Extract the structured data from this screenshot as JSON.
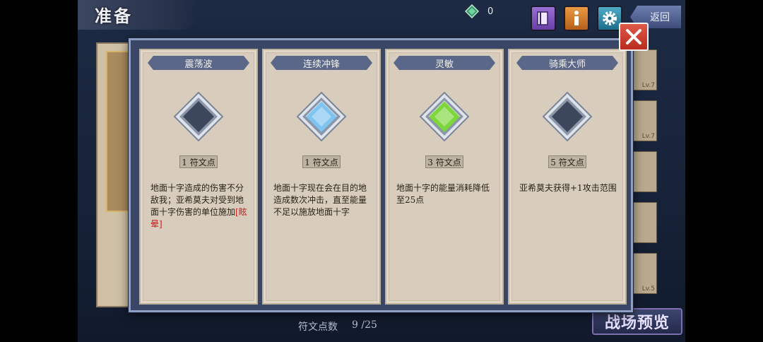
{
  "header": {
    "title": "准备",
    "gem_count": "0",
    "back_label": "返回"
  },
  "background": {
    "slot_levels": [
      "Lv.7",
      "Lv.7",
      "",
      "",
      "Lv.5"
    ],
    "battle_preview_label": "战场预览",
    "rune_points_label": "符文点数",
    "rune_points_value": "9 /25"
  },
  "cards": [
    {
      "title": "震荡波",
      "state": "inactive",
      "cost": "1 符文点",
      "desc": "地面十字造成的伤害不分敌我；亚希莫夫对受到地面十字伤害的单位施加",
      "highlight": "[眩晕]"
    },
    {
      "title": "连续冲锋",
      "state": "blue",
      "cost": "1 符文点",
      "desc": "地面十字现在会在目的地造成数次冲击，直至能量不足以施放地面十字",
      "highlight": ""
    },
    {
      "title": "灵敏",
      "state": "green",
      "cost": "3 符文点",
      "desc": "地面十字的能量消耗降低至25点",
      "highlight": ""
    },
    {
      "title": "骑乘大师",
      "state": "inactive",
      "cost": "5 符文点",
      "desc": "亚希莫夫获得+1攻击范围",
      "highlight": ""
    }
  ],
  "colors": {
    "inactive": "#3c475c",
    "blue": "#7fc4f0",
    "green": "#7dd63a",
    "close": "#c83a2c"
  }
}
